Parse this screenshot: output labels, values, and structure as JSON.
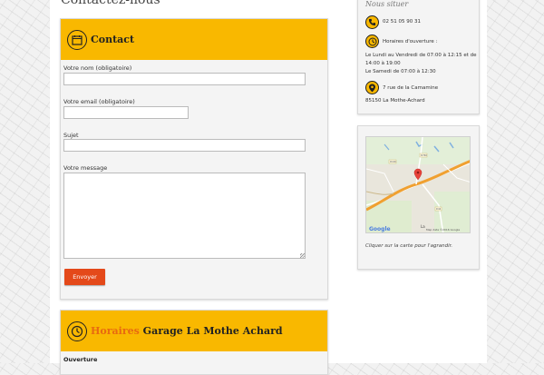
{
  "page_heading": "Contactez-nous",
  "contact": {
    "title": "Contact",
    "name_label": "Votre nom (obligatoire)",
    "name_value": "",
    "email_label": "Votre email (obligatoire)",
    "email_value": "",
    "subject_label": "Sujet",
    "subject_value": "",
    "message_label": "Votre message",
    "message_value": "",
    "send_label": "Envoyer"
  },
  "hours_card": {
    "title_accent": "Horaires",
    "title_rest": "Garage La Mothe Achard",
    "ouverture_label": "Ouverture"
  },
  "sidebar": {
    "title": "Nous situer",
    "phone": "02 51 05 90 31",
    "hours_label": "Horaires d'ouverture :",
    "hours_line1": "Le Lundi au Vendredi de 07:00 à 12:15 et de",
    "hours_line2": "14:00 à 19:00",
    "hours_line3": "Le Samedi de 07:00 à 12:30",
    "address_line1": "7 rue de la Camamine",
    "address_line2": "85150 La Mothe-Achard",
    "map_caption": "Cliquer sur la carte pour l'agrandir.",
    "map_google": "Google",
    "map_attribution": "Map data ©2016 Google",
    "map_road_1": "D760",
    "map_road_2": "D160",
    "map_road_3": "D42",
    "map_town": "La"
  },
  "colors": {
    "accent_yellow": "#f9b800",
    "accent_orange": "#e86a10",
    "button_red": "#e4491a"
  },
  "icons": {
    "contact": "calendar-icon",
    "hours": "clock-icon",
    "phone": "phone-icon",
    "location": "map-pin-icon"
  }
}
